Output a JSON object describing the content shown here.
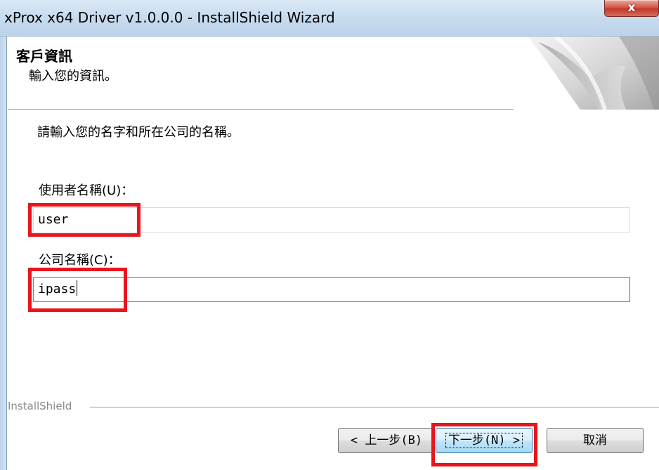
{
  "window": {
    "title": "xProx x64 Driver v1.0.0.0 - InstallShield Wizard",
    "close_glyph": "x"
  },
  "header": {
    "title": "客戶資訊",
    "subtitle": "輸入您的資訊。"
  },
  "body": {
    "description": "請輸入您的名字和所在公司的名稱。",
    "user_label": "使用者名稱(U)：",
    "user_value": "user",
    "company_label": "公司名稱(C)：",
    "company_value": "ipass"
  },
  "footer": {
    "brand": "InstallShield",
    "back_label": "< 上一步(B)",
    "next_label": "下一步(N) >",
    "cancel_label": "取消"
  },
  "colors": {
    "highlight": "#e8151d",
    "focus_border": "#5a93d6"
  }
}
